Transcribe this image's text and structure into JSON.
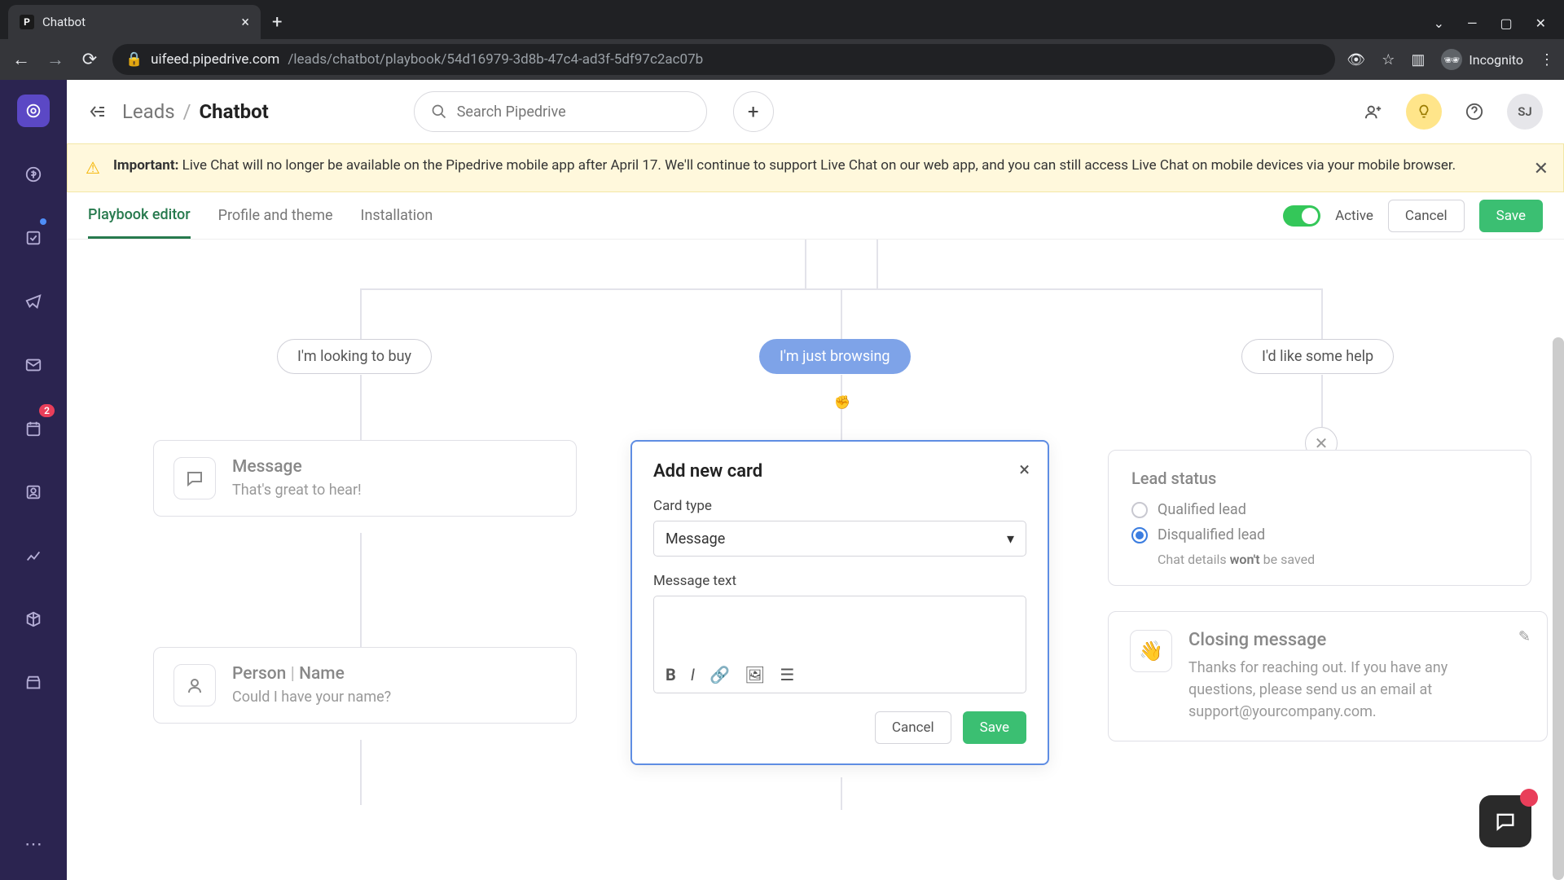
{
  "browser": {
    "tab_title": "Chatbot",
    "url_host": "uifeed.pipedrive.com",
    "url_path": "/leads/chatbot/playbook/54d16979-3d8b-47c4-ad3f-5df97c2ac07b",
    "incognito_label": "Incognito"
  },
  "header": {
    "crumb_parent": "Leads",
    "crumb_current": "Chatbot",
    "search_placeholder": "Search Pipedrive",
    "avatar_initials": "SJ"
  },
  "banner": {
    "strong": "Important:",
    "text": "Live Chat will no longer be available on the Pipedrive mobile app after April 17. We'll continue to support Live Chat on our web app, and you can still access Live Chat on mobile devices via your mobile browser."
  },
  "tabs": {
    "t1": "Playbook editor",
    "t2": "Profile and theme",
    "t3": "Installation",
    "state": "Active",
    "cancel": "Cancel",
    "save": "Save"
  },
  "sidebar_badge": "2",
  "chips": {
    "buy": "I'm looking to buy",
    "browse": "I'm just browsing",
    "help": "I'd like some help"
  },
  "cards": {
    "msg_title": "Message",
    "msg_body": "That's great to hear!",
    "person_title_a": "Person",
    "person_title_b": "Name",
    "person_body": "Could I have your name?"
  },
  "leadstatus": {
    "title": "Lead status",
    "opt1": "Qualified lead",
    "opt2": "Disqualified lead",
    "hint_pre": "Chat details ",
    "hint_bold": "won't",
    "hint_post": " be saved"
  },
  "closing": {
    "title": "Closing message",
    "body": "Thanks for reaching out. If you have any questions, please send us an email at support@yourcompany.com."
  },
  "modal": {
    "title": "Add new card",
    "card_type_label": "Card type",
    "card_type_value": "Message",
    "msg_text_label": "Message text",
    "cancel": "Cancel",
    "save": "Save"
  }
}
